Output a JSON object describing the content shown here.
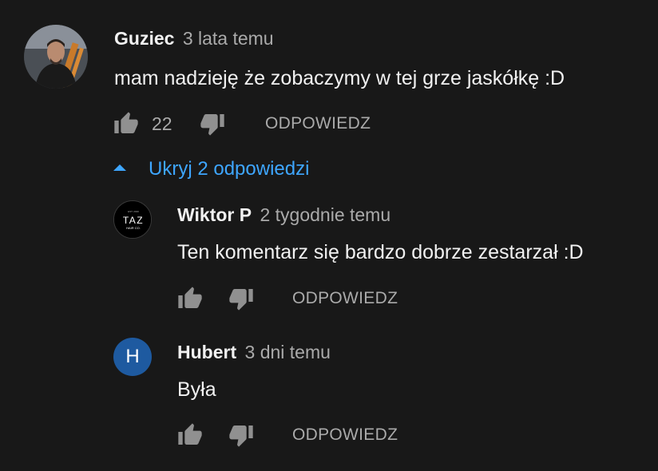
{
  "comments": [
    {
      "author": "Guziec",
      "time": "3 lata temu",
      "text": "mam nadzieję że zobaczymy w tej grze jaskółkę :D",
      "likes": "22",
      "reply_label": "ODPOWIEDZ"
    }
  ],
  "replies_toggle": {
    "label": "Ukryj 2 odpowiedzi"
  },
  "replies": [
    {
      "author": "Wiktor P",
      "time": "2 tygodnie temu",
      "text": "Ten komentarz się bardzo dobrze zestarzał :D",
      "reply_label": "ODPOWIEDZ",
      "avatar_logo": "TAZ",
      "avatar_logo_small": "HAIR CO."
    },
    {
      "author": "Hubert",
      "time": "3 dni temu",
      "text": "Była",
      "reply_label": "ODPOWIEDZ",
      "avatar_letter": "H",
      "avatar_color": "#1e5aa0"
    }
  ],
  "colors": {
    "background": "#181818",
    "link": "#3ea6ff",
    "secondary_text": "#aaaaaa"
  }
}
